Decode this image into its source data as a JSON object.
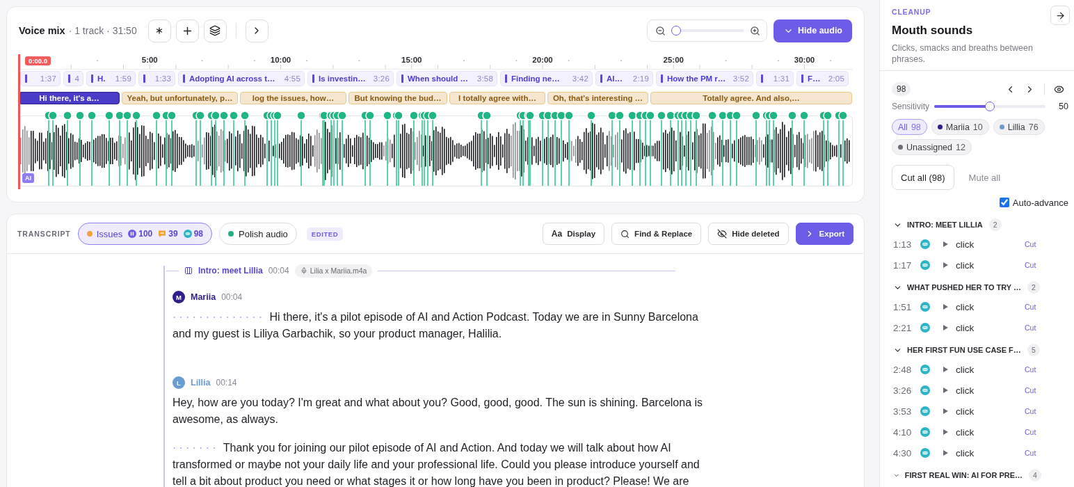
{
  "timeline_panel": {
    "title": "Voice mix",
    "meta": "· 1 track · 31:50",
    "zoom": {
      "level": 0
    },
    "hide_audio_button": "Hide audio",
    "playhead": "0:00.0",
    "ruler_labels": [
      "5:00",
      "10:00",
      "15:00",
      "20:00",
      "25:00",
      "30:00"
    ],
    "chapters": [
      {
        "duration": "1:37"
      },
      {
        "duration": "4"
      },
      {
        "title": "H.",
        "duration": "1:59"
      },
      {
        "duration": "1:33"
      },
      {
        "title": "Adopting AI across t…",
        "duration": "4:55"
      },
      {
        "title": "Is investin…",
        "duration": "3:26"
      },
      {
        "title": "When should …",
        "duration": "3:58"
      },
      {
        "title": "Finding ne…",
        "duration": "3:42"
      },
      {
        "title": "AI…",
        "duration": "2:19"
      },
      {
        "title": "How the PM r…",
        "duration": "3:52"
      },
      {
        "duration": "1:31"
      },
      {
        "title": "F…",
        "duration": "2:05"
      }
    ],
    "segments": [
      {
        "text": "Hi there, it's a…",
        "selected": true
      },
      {
        "text": "Yeah, but unfortunately, p…",
        "selected": false
      },
      {
        "text": "log the issues, how…",
        "selected": false
      },
      {
        "text": "But knowing the bud…",
        "selected": false
      },
      {
        "text": "I totally agree with…",
        "selected": false
      },
      {
        "text": "Oh, that's interesting …",
        "selected": false
      },
      {
        "text": "Totally agree. And also,…",
        "selected": false
      }
    ],
    "ai_badge": "AI"
  },
  "transcript": {
    "label": "TRANSCRIPT",
    "issues": {
      "label": "Issues",
      "counts": [
        {
          "kind": "pause",
          "value": "100"
        },
        {
          "kind": "comment",
          "value": "39"
        },
        {
          "kind": "mouth",
          "value": "98"
        }
      ]
    },
    "polish_audio": "Polish audio",
    "status_badge": "EDITED",
    "actions": [
      {
        "kind": "display",
        "glyph": "Aa",
        "label": "Display"
      },
      {
        "kind": "find",
        "label": "Find & Replace"
      },
      {
        "kind": "hide",
        "label": "Hide deleted"
      },
      {
        "kind": "export",
        "label": "Export"
      }
    ],
    "chapter": {
      "title": "Intro: meet Lillia",
      "time": "00:04",
      "file": "Lilia x Mariia.m4a"
    },
    "blocks": [
      {
        "speaker": "Mariia",
        "initial": "M",
        "color": "#2e1f8a",
        "time": "00:04",
        "paragraphs": [
          {
            "pause": "··············",
            "text": "Hi there, it's a pilot episode of AI and Action Podcast. Today we are in Sunny Barcelona and my guest is Liliya Garbachik, so your product manager, Halilia."
          }
        ]
      },
      {
        "speaker": "Lillia",
        "initial": "L",
        "color": "#6a9bd3",
        "time": "00:14",
        "paragraphs": [
          {
            "text": "Hey, how are you today? I'm great and what about you? Good, good, good. The sun is shining. Barcelona is awesome, as always."
          },
          {
            "pause": "·······",
            "text": "Thank you for joining our pilot episode of AI and Action. And today we will talk about how AI transformed or maybe not your daily life and your professional life. Could you please introduce yourself and tell a bit about product you need or what stages it or how long have you been in product? Please! We are"
          }
        ]
      }
    ]
  },
  "cleanup_panel": {
    "section": "CLEANUP",
    "title": "Mouth sounds",
    "description": "Clicks, smacks and breaths between phrases.",
    "total": "98",
    "sensitivity": {
      "label": "Sensitivity",
      "level": 0.5,
      "value": "50"
    },
    "filters": [
      {
        "label": "All",
        "count": "98",
        "selected": true
      },
      {
        "label": "Mariia",
        "count": "10",
        "color": "#2e1f8a",
        "selected": false
      },
      {
        "label": "Lillia",
        "count": "76",
        "color": "#6a9bd3",
        "selected": false
      },
      {
        "label": "Unassigned",
        "count": "12",
        "color": "#6e6e78",
        "selected": false
      }
    ],
    "cut_all": "Cut all (98)",
    "mute_all": "Mute all",
    "auto_advance": {
      "label": "Auto-advance",
      "checked": true
    },
    "groups": [
      {
        "title": "INTRO: MEET LILLIA",
        "count": "2",
        "expanded": true,
        "items": [
          {
            "time": "1:13",
            "label": "click",
            "action": "Cut"
          },
          {
            "time": "1:17",
            "label": "click",
            "action": "Cut"
          }
        ]
      },
      {
        "title": "WHAT PUSHED HER TO TRY …",
        "count": "2",
        "expanded": true,
        "items": [
          {
            "time": "1:51",
            "label": "click",
            "action": "Cut"
          },
          {
            "time": "2:21",
            "label": "click",
            "action": "Cut"
          }
        ]
      },
      {
        "title": "HER FIRST FUN USE CASE F…",
        "count": "5",
        "expanded": true,
        "items": [
          {
            "time": "2:48",
            "label": "click",
            "action": "Cut"
          },
          {
            "time": "3:26",
            "label": "click",
            "action": "Cut"
          },
          {
            "time": "3:53",
            "label": "click",
            "action": "Cut"
          },
          {
            "time": "4:10",
            "label": "click",
            "action": "Cut"
          },
          {
            "time": "4:30",
            "label": "click",
            "action": "Cut"
          }
        ]
      },
      {
        "title": "FIRST REAL WIN: AI FOR PRE…",
        "count": "4",
        "expanded": true
      }
    ]
  }
}
